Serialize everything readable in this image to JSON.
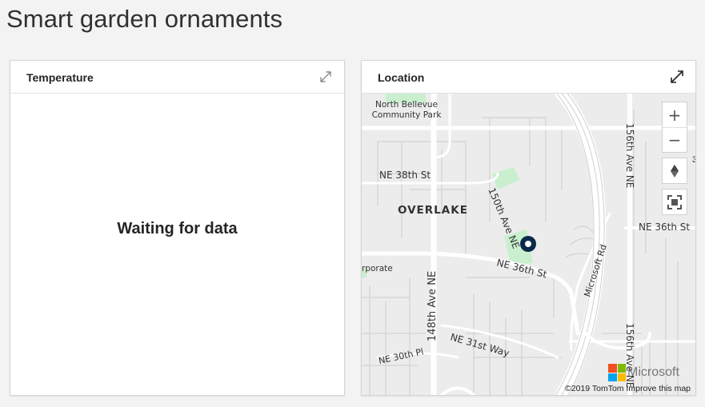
{
  "page": {
    "title": "Smart garden ornaments"
  },
  "tiles": {
    "temperature": {
      "title": "Temperature",
      "status": "Waiting for data",
      "expand_icon": "expand-icon"
    },
    "location": {
      "title": "Location",
      "expand_icon": "expand-icon",
      "map": {
        "labels": {
          "park": [
            "North Bellevue",
            "Community Park"
          ],
          "ne38": "NE 38th St",
          "overlake": "OVERLAKE",
          "ave150": "150th Ave NE",
          "ne36_right": "NE 36th St",
          "ne36_mid": "NE 36th St",
          "ave148": "148th Ave NE",
          "ave156_top": "156th Ave NE",
          "ave156_bottom": "156th Ave NE",
          "microsoft_rd": "Microsoft Rd",
          "ne31": "NE 31st Way",
          "ne30": "NE 30th Pl",
          "corporate": "rporate",
          "edge_digit": "3"
        },
        "controls": {
          "zoom_in": "+",
          "zoom_out": "−",
          "compass": "compass-icon",
          "fullscreen": "fullscreen-icon"
        },
        "brand": "Microsoft",
        "attribution": {
          "copyright": "©2019 TomTom",
          "improve_link": "Improve this map"
        },
        "pin_icon": "location-pin-icon"
      }
    }
  },
  "colors": {
    "pin": "#0b2a4a",
    "park": "#c9efcf",
    "road": "#ffffff",
    "map_bg": "#ececec"
  }
}
